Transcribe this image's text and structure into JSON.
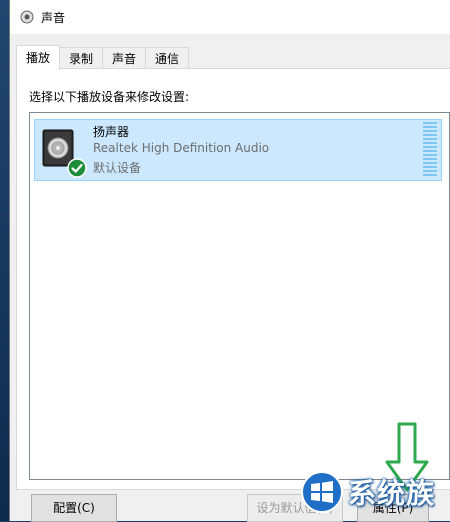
{
  "window": {
    "title": "声音"
  },
  "tabs": [
    {
      "label": "播放",
      "active": true
    },
    {
      "label": "录制",
      "active": false
    },
    {
      "label": "声音",
      "active": false
    },
    {
      "label": "通信",
      "active": false
    }
  ],
  "panel": {
    "instruction": "选择以下播放设备来修改设置:"
  },
  "devices": [
    {
      "name": "扬声器",
      "driver": "Realtek High Definition Audio",
      "status": "默认设备",
      "selected": true,
      "default_badge": "check-icon"
    }
  ],
  "buttons": {
    "configure": "配置(C)",
    "set_default": "设为默认值(S)",
    "properties": "属性(P)"
  },
  "watermark": {
    "text": "系统族"
  },
  "colors": {
    "selection_bg": "#cce8ff",
    "selection_border": "#99d1ff",
    "check_badge": "#1e8c3a",
    "arrow": "#2fa84f"
  }
}
